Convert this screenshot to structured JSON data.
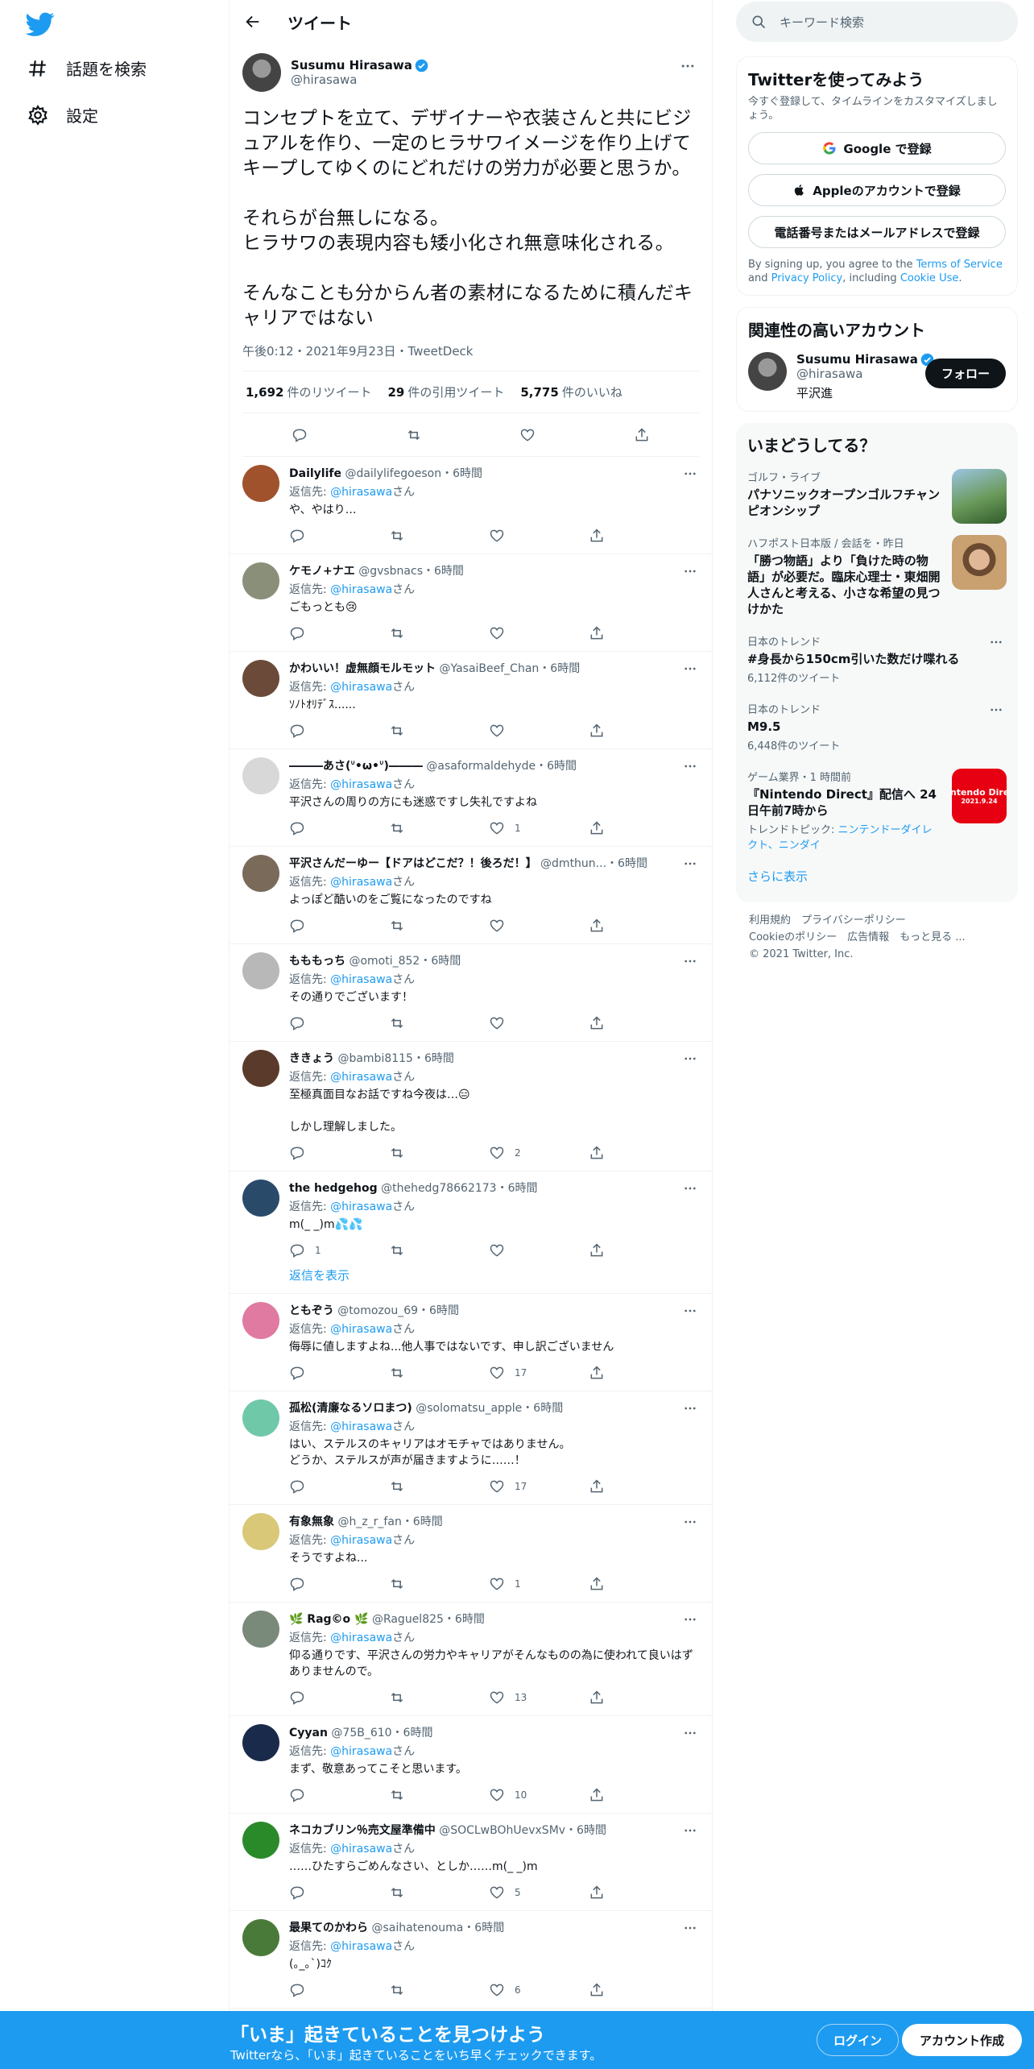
{
  "sidebar": {
    "items": [
      {
        "label": "話題を検索",
        "icon": "hashtag-icon"
      },
      {
        "label": "設定",
        "icon": "gear-icon"
      }
    ]
  },
  "header": {
    "title": "ツイート"
  },
  "tweet": {
    "author": {
      "name": "Susumu Hirasawa",
      "handle": "@hirasawa"
    },
    "text": "コンセプトを立て、デザイナーや衣装さんと共にビジュアルを作り、一定のヒラサワイメージを作り上げてキープしてゆくのにどれだけの労力が必要と思うか。\n\nそれらが台無しになる。\nヒラサワの表現内容も矮小化され無意味化される。\n\nそんなことも分からん者の素材になるために積んだキャリアではない",
    "meta": "午後0:12・2021年9月23日・TweetDeck",
    "retweets": {
      "count": "1,692",
      "label": "件のリツイート"
    },
    "quotes": {
      "count": "29",
      "label": "件の引用ツイート"
    },
    "likes": {
      "count": "5,775",
      "label": "件のいいね"
    }
  },
  "replies": [
    {
      "name": "Dailylife",
      "handle": "@dailylifegoeson",
      "time": "・6時間",
      "to_prefix": "返信先: ",
      "to": "@hirasawa",
      "to_suffix": "さん",
      "text": "や、やはり…",
      "replies": "",
      "retweets": "",
      "likes": "",
      "avatar_color": "#a0522d"
    },
    {
      "name": "ケモノ+ナエ",
      "handle": "@gvsbnacs",
      "time": "・6時間",
      "to_prefix": "返信先: ",
      "to": "@hirasawa",
      "to_suffix": "さん",
      "text": "ごもっとも😢",
      "replies": "",
      "retweets": "",
      "likes": "",
      "avatar_color": "#8a8f7a"
    },
    {
      "name": "かわいい！虚無顔モルモット",
      "handle": "@YasaiBeef_Chan",
      "time": "・6時間",
      "to_prefix": "返信先: ",
      "to": "@hirasawa",
      "to_suffix": "さん",
      "text": "ｿﾉﾄｵﾘﾃﾞｽ......",
      "replies": "",
      "retweets": "",
      "likes": "",
      "avatar_color": "#6b4a3a"
    },
    {
      "name": "―――あさ(ᐡ•ω•ᐡ)―――",
      "handle": "@asaformaldehyde",
      "time": "・6時間",
      "to_prefix": "返信先: ",
      "to": "@hirasawa",
      "to_suffix": "さん",
      "text": "平沢さんの周りの方にも迷惑ですし失礼ですよね",
      "replies": "",
      "retweets": "",
      "likes": "1",
      "avatar_color": "#d8d8d8"
    },
    {
      "name": "平沢さんだーゆー【ドアはどこだ？！後ろだ！】",
      "handle": "@dmthun...",
      "time": "・6時間",
      "to_prefix": "返信先: ",
      "to": "@hirasawa",
      "to_suffix": "さん",
      "text": "よっぽど酷いのをご覧になったのですね",
      "replies": "",
      "retweets": "",
      "likes": "",
      "avatar_color": "#7a6a5a"
    },
    {
      "name": "もももっち",
      "handle": "@omoti_852",
      "time": "・6時間",
      "to_prefix": "返信先: ",
      "to": "@hirasawa",
      "to_suffix": "さん",
      "text": "その通りでございます！",
      "replies": "",
      "retweets": "",
      "likes": "",
      "avatar_color": "#b8b8b8"
    },
    {
      "name": "ききょう",
      "handle": "@bambi8115",
      "time": "・6時間",
      "to_prefix": "返信先: ",
      "to": "@hirasawa",
      "to_suffix": "さん",
      "text": "至極真面目なお話ですね今夜は…😑\n\nしかし理解しました。",
      "replies": "",
      "retweets": "",
      "likes": "2",
      "avatar_color": "#5a3a2a"
    },
    {
      "name": "the hedgehog",
      "handle": "@thehedg78662173",
      "time": "・6時間",
      "to_prefix": "返信先: ",
      "to": "@hirasawa",
      "to_suffix": "さん",
      "text": "m(_ _)m💦💦",
      "replies": "1",
      "retweets": "",
      "likes": "",
      "avatar_color": "#2a4a6a",
      "show_replies": "返信を表示"
    },
    {
      "name": "ともぞう",
      "handle": "@tomozou_69",
      "time": "・6時間",
      "to_prefix": "返信先: ",
      "to": "@hirasawa",
      "to_suffix": "さん",
      "text": "侮辱に値しますよね...他人事ではないです、申し訳ございません",
      "replies": "",
      "retweets": "",
      "likes": "17",
      "avatar_color": "#e07aa0"
    },
    {
      "name": "孤松(清廉なるソロまつ)",
      "handle": "@solomatsu_apple",
      "time": "・6時間",
      "to_prefix": "返信先: ",
      "to": "@hirasawa",
      "to_suffix": "さん",
      "text": "はい、ステルスのキャリアはオモチャではありません。\nどうか、ステルスが声が届きますように……！",
      "replies": "",
      "retweets": "",
      "likes": "17",
      "avatar_color": "#6fc9a8"
    },
    {
      "name": "有象無象",
      "handle": "@h_z_r_fan",
      "time": "・6時間",
      "to_prefix": "返信先: ",
      "to": "@hirasawa",
      "to_suffix": "さん",
      "text": "そうですよね...",
      "replies": "",
      "retweets": "",
      "likes": "1",
      "avatar_color": "#d8c878"
    },
    {
      "name": "🌿 Rag©o 🌿",
      "handle": "@Raguel825",
      "time": "・6時間",
      "to_prefix": "返信先: ",
      "to": "@hirasawa",
      "to_suffix": "さん",
      "text": "仰る通りです、平沢さんの労力やキャリアがそんなものの為に使われて良いはずありませんので。",
      "replies": "",
      "retweets": "",
      "likes": "13",
      "avatar_color": "#7a8a7a"
    },
    {
      "name": "Cyyan",
      "handle": "@75B_610",
      "time": "・6時間",
      "to_prefix": "返信先: ",
      "to": "@hirasawa",
      "to_suffix": "さん",
      "text": "まず、敬意あってこそと思います。",
      "replies": "",
      "retweets": "",
      "likes": "10",
      "avatar_color": "#1a2a4a"
    },
    {
      "name": "ネコカブリン％売文屋準備中",
      "handle": "@SOCLwBOhUevxSMv",
      "time": "・6時間",
      "to_prefix": "返信先: ",
      "to": "@hirasawa",
      "to_suffix": "さん",
      "text": "……ひたすらごめんなさい、としか……m(_ _)m",
      "replies": "",
      "retweets": "",
      "likes": "5",
      "avatar_color": "#2a8a2a"
    },
    {
      "name": "最果てのかわら",
      "handle": "@saihatenouma",
      "time": "・6時間",
      "to_prefix": "返信先: ",
      "to": "@hirasawa",
      "to_suffix": "さん",
      "text": "(｡_｡`)ｺｸ",
      "replies": "",
      "retweets": "",
      "likes": "6",
      "avatar_color": "#4a7a3a"
    }
  ],
  "right": {
    "search_placeholder": "キーワード検索",
    "signup": {
      "title": "Twitterを使ってみよう",
      "subtitle": "今すぐ登録して、タイムラインをカスタマイズしましょう。",
      "google": "Google で登録",
      "apple": "Appleのアカウントで登録",
      "phone": "電話番号またはメールアドレスで登録",
      "terms_prefix": "By signing up, you agree to the ",
      "terms_link": "Terms of Service",
      "terms_and": " and ",
      "privacy_link": "Privacy Policy",
      "terms_including": ", including ",
      "cookie_link": "Cookie Use",
      "terms_end": "."
    },
    "related": {
      "title": "関連性の高いアカウント",
      "name": "Susumu Hirasawa",
      "handle": "@hirasawa",
      "bio": "平沢進",
      "follow": "フォロー"
    },
    "trends": {
      "title": "いまどうしてる？",
      "items": [
        {
          "context": "ゴルフ・ライブ",
          "title": "パナソニックオープンゴルフチャンピオンシップ",
          "count": "",
          "image": "golf-photo"
        },
        {
          "context": "ハフポスト日本版 / 会話を・昨日",
          "title": "「勝つ物語」より「負けた時の物語」が必要だ。臨床心理士・東畑開人さんと考える、小さな希望の見つけかた",
          "count": "",
          "image": "person-photo"
        },
        {
          "context": "日本のトレンド",
          "title": "#身長から150cm引いた数だけ喋れる",
          "count": "6,112件のツイート",
          "image": ""
        },
        {
          "context": "日本のトレンド",
          "title": "M9.5",
          "count": "6,448件のツイート",
          "image": ""
        },
        {
          "context": "ゲーム業界・1 時間前",
          "title": "『Nintendo Direct』配信へ 24日午前7時から",
          "count": "",
          "topics_prefix": "トレンドトピック: ",
          "topics": "ニンテンドーダイレクト、ニンダイ",
          "image": "nintendo-direct-banner",
          "image_text": "Nintendo Direct",
          "image_date": "2021.9.24"
        }
      ],
      "more": "さらに表示"
    },
    "footer": {
      "line1": "利用規約　プライバシーポリシー",
      "line2": "Cookieのポリシー　広告情報　もっと見る ...",
      "line3": "© 2021 Twitter, Inc."
    }
  },
  "bottom": {
    "title": "「いま」起きていることを見つけよう",
    "subtitle": "Twitterなら、「いま」起きていることをいち早くチェックできます。",
    "login": "ログイン",
    "signup": "アカウント作成"
  },
  "colors": {
    "accent": "#1d9bf0",
    "text": "#0f1419",
    "muted": "#536471"
  }
}
